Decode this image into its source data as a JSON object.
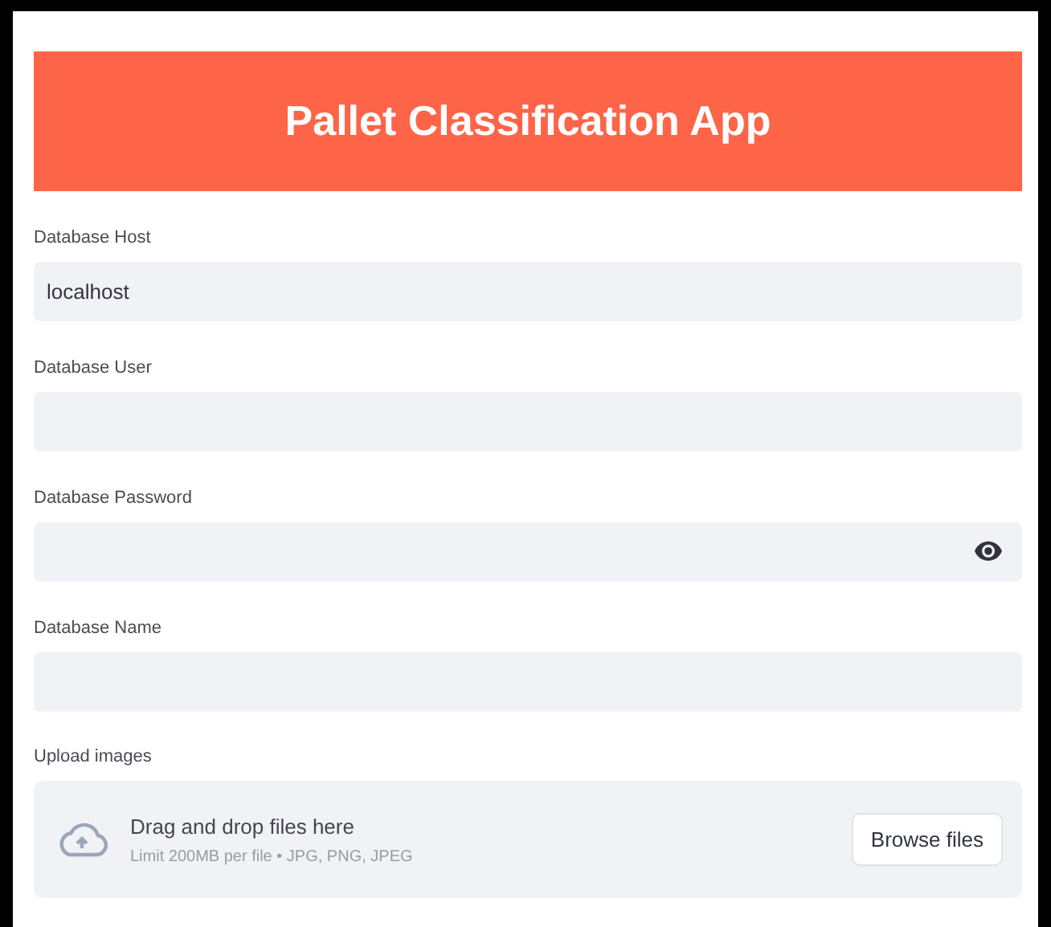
{
  "header": {
    "title": "Pallet Classification App"
  },
  "fields": [
    {
      "label": "Database Host",
      "kind": "text",
      "value": "localhost"
    },
    {
      "label": "Database User",
      "kind": "text"
    },
    {
      "label": "Database Password",
      "kind": "password"
    },
    {
      "label": "Database Name",
      "kind": "text"
    }
  ],
  "uploader": {
    "label": "Upload images",
    "instruction": "Drag and drop files here",
    "limits": "Limit 200MB per file • JPG, PNG, JPEG",
    "button": "Browse files"
  }
}
